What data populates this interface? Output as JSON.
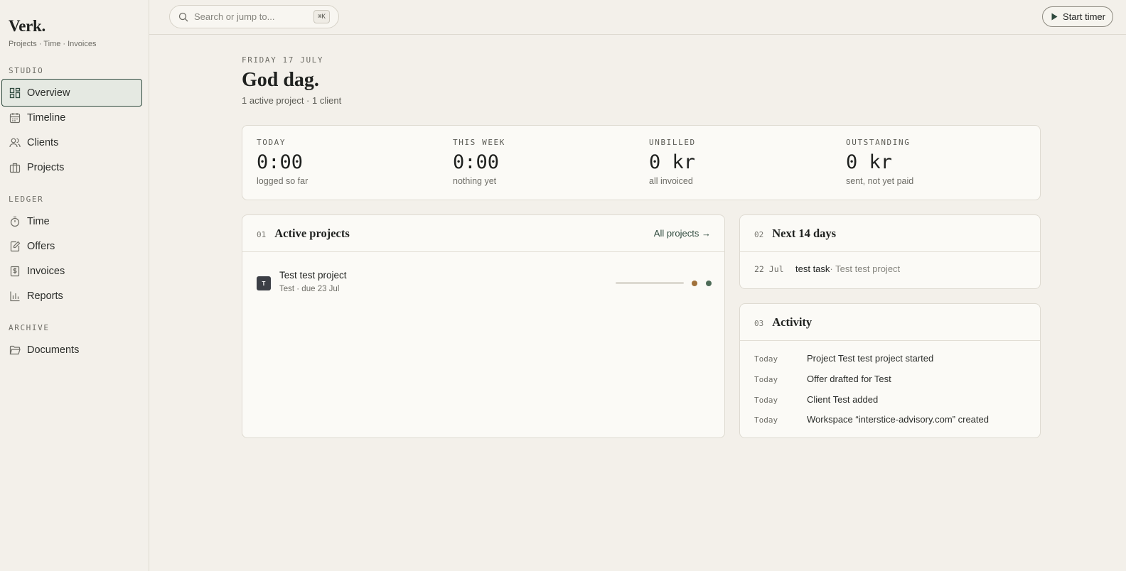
{
  "brand": {
    "name": "Verk.",
    "tagline": "Projects · Time · Invoices"
  },
  "sidebar": {
    "sections": [
      {
        "label": "STUDIO",
        "items": [
          {
            "label": "Overview",
            "icon": "grid-icon",
            "active": true
          },
          {
            "label": "Timeline",
            "icon": "calendar-icon"
          },
          {
            "label": "Clients",
            "icon": "users-icon"
          },
          {
            "label": "Projects",
            "icon": "briefcase-icon"
          }
        ]
      },
      {
        "label": "LEDGER",
        "items": [
          {
            "label": "Time",
            "icon": "stopwatch-icon"
          },
          {
            "label": "Offers",
            "icon": "edit-doc-icon"
          },
          {
            "label": "Invoices",
            "icon": "dollar-doc-icon"
          },
          {
            "label": "Reports",
            "icon": "bar-chart-icon"
          }
        ]
      },
      {
        "label": "ARCHIVE",
        "items": [
          {
            "label": "Documents",
            "icon": "folder-icon"
          }
        ]
      }
    ]
  },
  "topbar": {
    "search_placeholder": "Search or jump to...",
    "search_shortcut": "⌘K",
    "start_timer_label": "Start timer"
  },
  "header": {
    "date": "FRIDAY 17 JULY",
    "greeting": "God dag.",
    "summary": "1 active project · 1 client"
  },
  "stats": [
    {
      "label": "TODAY",
      "value": "0:00",
      "sub": "logged so far"
    },
    {
      "label": "THIS WEEK",
      "value": "0:00",
      "sub": "nothing yet"
    },
    {
      "label": "UNBILLED",
      "value": "0 kr",
      "sub": "all invoiced"
    },
    {
      "label": "OUTSTANDING",
      "value": "0 kr",
      "sub": "sent, not yet paid"
    }
  ],
  "active_projects": {
    "number": "01",
    "title": "Active projects",
    "link_label": "All projects →",
    "items": [
      {
        "initial": "T",
        "name": "Test test project",
        "meta": "Test · due 23 Jul",
        "progress": 0,
        "status_colors": [
          "#a0713a",
          "#4d6b57"
        ]
      }
    ]
  },
  "next_days": {
    "number": "02",
    "title": "Next 14 days",
    "items": [
      {
        "date": "22 Jul",
        "task": "test task",
        "project": " · Test test project"
      }
    ]
  },
  "activity": {
    "number": "03",
    "title": "Activity",
    "items": [
      {
        "when": "Today",
        "text": "Project Test test project started"
      },
      {
        "when": "Today",
        "text": "Offer drafted for Test"
      },
      {
        "when": "Today",
        "text": "Client Test added"
      },
      {
        "when": "Today",
        "text": "Workspace “interstice-advisory.com” created"
      }
    ]
  },
  "colors": {
    "accent": "#2f4a3e",
    "background": "#f3f0ea",
    "card": "#fbfaf6"
  }
}
